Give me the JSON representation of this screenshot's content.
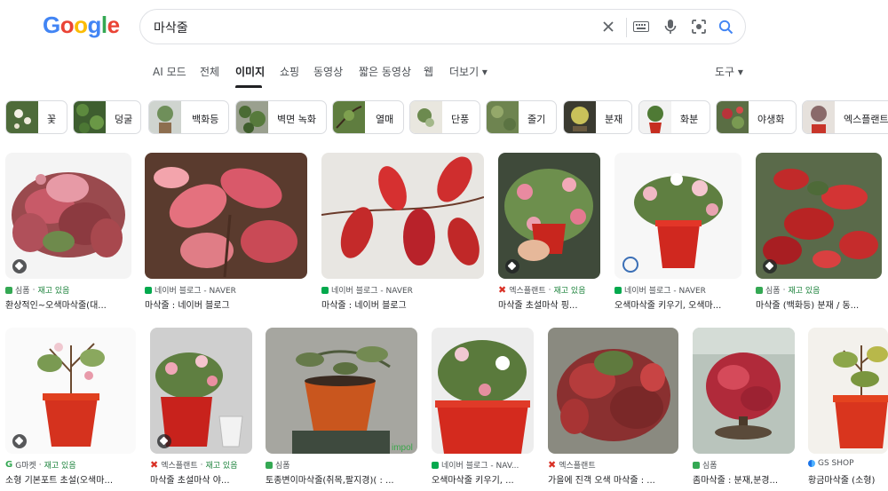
{
  "logo": {
    "letters": [
      "G",
      "o",
      "o",
      "g",
      "l",
      "e"
    ]
  },
  "search": {
    "query": "마삭줄"
  },
  "tabs": [
    "AI 모드",
    "전체",
    "이미지",
    "쇼핑",
    "동영상",
    "짧은 동영상",
    "웹",
    "더보기 ▾"
  ],
  "active_tab": "이미지",
  "tools_label": "도구 ▾",
  "chips": [
    "꽃",
    "덩굴",
    "백화등",
    "벽면 녹화",
    "열매",
    "단풍",
    "줄기",
    "분재",
    "화분",
    "야생화",
    "엑스플랜트"
  ],
  "results_row1": [
    {
      "source": "심폼",
      "stock": "재고 있음",
      "title": "환상적인~오색마삭줄(대..."
    },
    {
      "source": "네이버 블로그 - NAVER",
      "stock": "",
      "title": "마삭줄 : 네이버 블로그"
    },
    {
      "source": "네이버 블로그 - NAVER",
      "stock": "",
      "title": "마삭줄 : 네이버 블로그"
    },
    {
      "source": "엑스플랜트",
      "stock": "재고 있음",
      "title": "마삭줄 초설마삭 핑..."
    },
    {
      "source": "네이버 블로그 - NAVER",
      "stock": "",
      "title": "오색마삭줄 키우기, 오색마..."
    },
    {
      "source": "심폼",
      "stock": "재고 있음",
      "title": "마삭줄 (백화등) 분재 / 동..."
    }
  ],
  "results_row2": [
    {
      "source": "G마켓",
      "stock": "재고 있음",
      "title": "소형 기본포트 초설(오색마..."
    },
    {
      "source": "엑스플랜트",
      "stock": "재고 있음",
      "title": "마삭줄 초설마삭 야..."
    },
    {
      "source": "심폼",
      "stock": "",
      "title": "토종변이마삭줄(취목,팔지경)( : ..."
    },
    {
      "source": "네이버 블로그 - NAV...",
      "stock": "",
      "title": "오색마삭줄 키우기, ..."
    },
    {
      "source": "엑스플랜트",
      "stock": "",
      "title": "가을에 진객 오색 마삭줄 : ..."
    },
    {
      "source": "심폼",
      "stock": "",
      "title": "좀마삭줄 : 분재,분경..."
    },
    {
      "source": "GS SHOP",
      "stock": "",
      "title": "황금마삭줄 (소형)"
    }
  ],
  "watermarks": {
    "r2_3": "impol"
  },
  "colors": {
    "google_blue": "#4285F4",
    "google_red": "#EA4335",
    "google_yellow": "#FBBC05",
    "google_green": "#34A853",
    "stock_green": "#188038"
  }
}
